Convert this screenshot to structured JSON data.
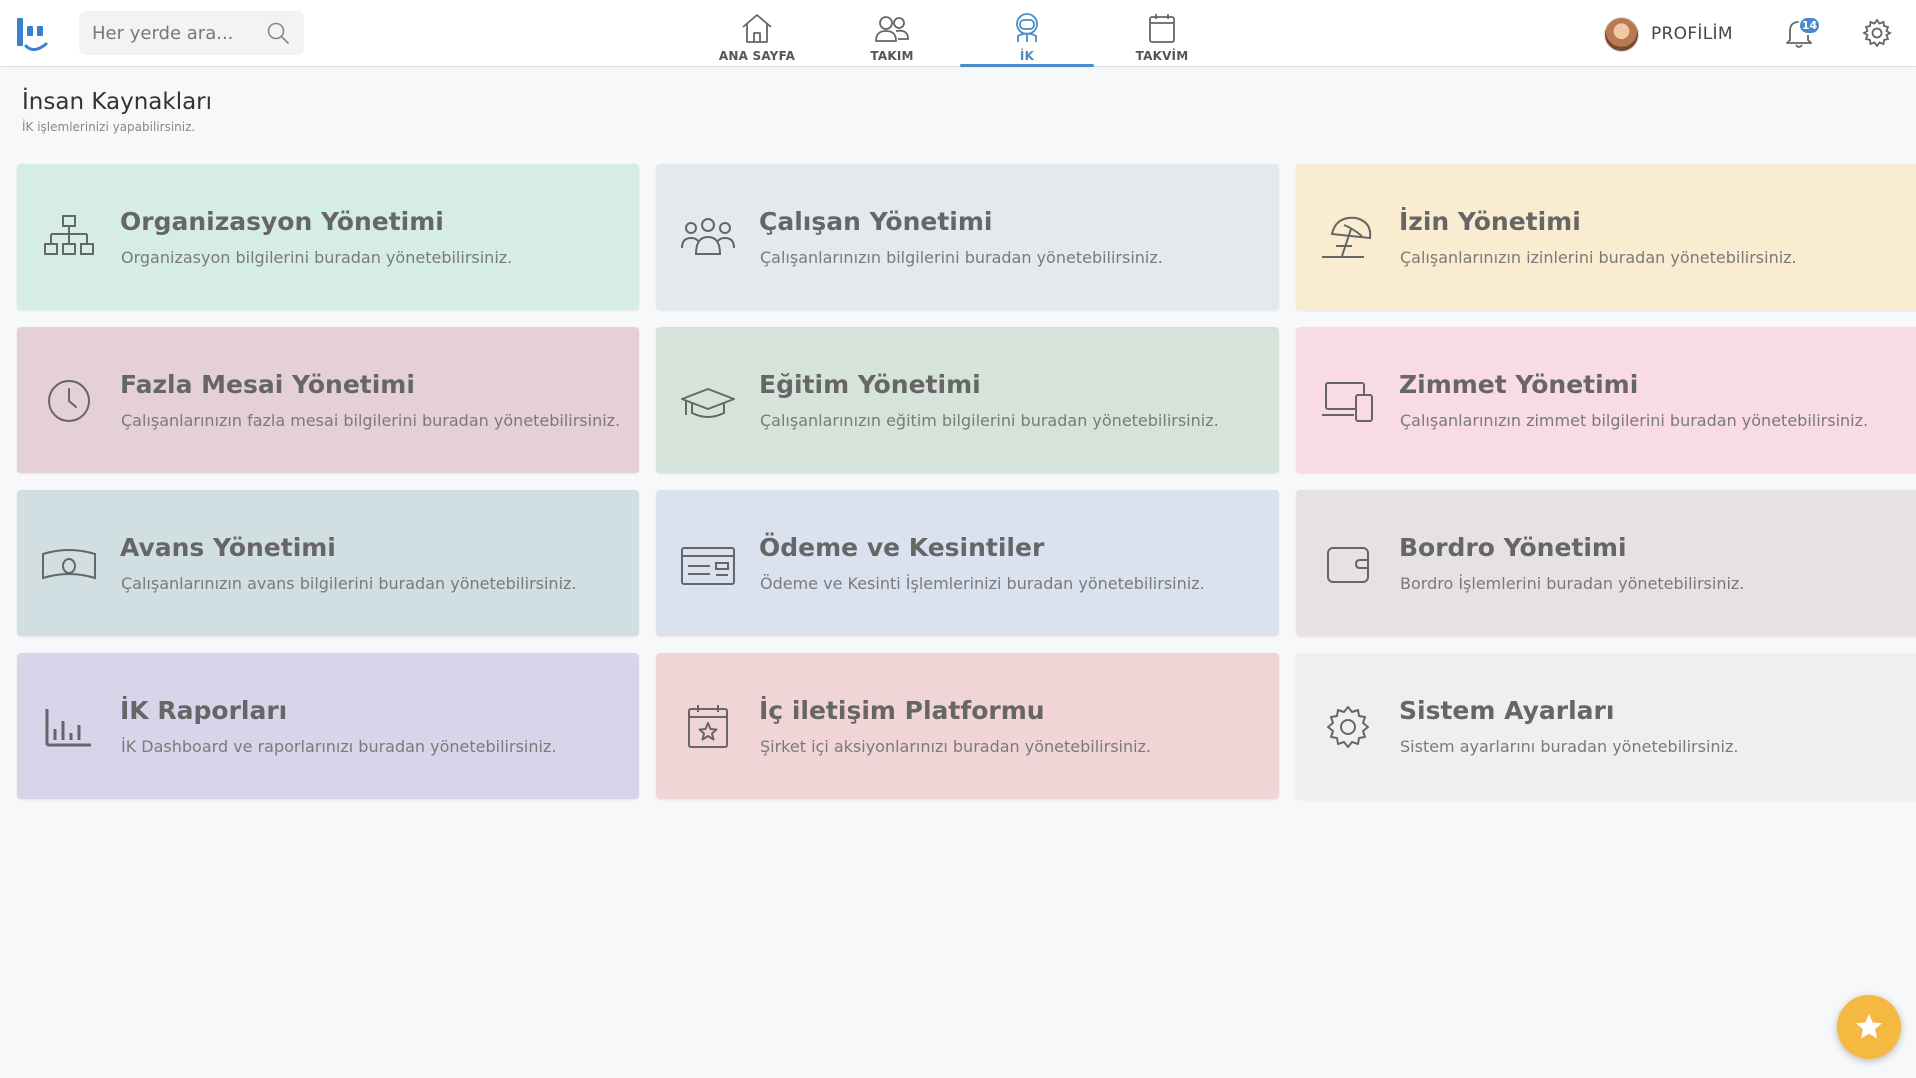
{
  "search": {
    "placeholder": "Her yerde ara..."
  },
  "nav": {
    "items": [
      {
        "label": "ANA SAYFA"
      },
      {
        "label": "TAKIM"
      },
      {
        "label": "İK"
      },
      {
        "label": "TAKVİM"
      }
    ]
  },
  "profile": {
    "label": "PROFİLİM"
  },
  "notifications": {
    "count": "14"
  },
  "page": {
    "title": "İnsan Kaynakları",
    "subtitle": "İK işlemlerinizi yapabilirsiniz."
  },
  "cards": [
    {
      "title": "Organizasyon Yönetimi",
      "desc": "Organizasyon bilgilerini buradan yönetebilirsiniz.",
      "icon": "org-chart-icon",
      "color": "#d6ede3"
    },
    {
      "title": "Çalışan Yönetimi",
      "desc": "Çalışanlarınızın bilgilerini buradan yönetebilirsiniz.",
      "icon": "users-icon",
      "color": "#e3e9ec"
    },
    {
      "title": "İzin Yönetimi",
      "desc": "Çalışanlarınızın izinlerini buradan yönetebilirsiniz.",
      "icon": "beach-umbrella-icon",
      "color": "#faecd0"
    },
    {
      "title": "Fazla Mesai Yönetimi",
      "desc": "Çalışanlarınızın fazla mesai bilgilerini buradan yönetebilirsiniz.",
      "icon": "clock-icon",
      "color": "#e6d0d8"
    },
    {
      "title": "Eğitim Yönetimi",
      "desc": "Çalışanlarınızın eğitim bilgilerini buradan yönetebilirsiniz.",
      "icon": "graduation-cap-icon",
      "color": "#d6e3da"
    },
    {
      "title": "Zimmet Yönetimi",
      "desc": "Çalışanlarınızın zimmet bilgilerini buradan yönetebilirsiniz.",
      "icon": "devices-icon",
      "color": "#f8dbe3"
    },
    {
      "title": "Avans Yönetimi",
      "desc": "Çalışanlarınızın avans bilgilerini buradan yönetebilirsiniz.",
      "icon": "money-icon",
      "color": "#d1dee2"
    },
    {
      "title": "Ödeme ve Kesintiler",
      "desc": "Ödeme ve Kesinti İşlemlerinizi buradan yönetebilirsiniz.",
      "icon": "payment-card-icon",
      "color": "#dbe2ef"
    },
    {
      "title": "Bordro Yönetimi",
      "desc": "Bordro İşlemlerini buradan yönetebilirsiniz.",
      "icon": "wallet-icon",
      "color": "#e5e2e1"
    },
    {
      "title": "İK Raporları",
      "desc": "İK Dashboard ve raporlarınızı buradan yönetebilirsiniz.",
      "icon": "bar-chart-icon",
      "color": "#d8d5ea"
    },
    {
      "title": "İç iletişim Platformu",
      "desc": "Şirket içi aksiyonlarınızı buradan yönetebilirsiniz.",
      "icon": "calendar-star-icon",
      "color": "#f1d4d6"
    },
    {
      "title": "Sistem Ayarları",
      "desc": "Sistem ayarlarını buradan yönetebilirsiniz.",
      "icon": "gear-icon",
      "color": "#eeeff1"
    }
  ],
  "colors": {
    "accent": "#4a8bc7",
    "fab": "#f5b942"
  }
}
